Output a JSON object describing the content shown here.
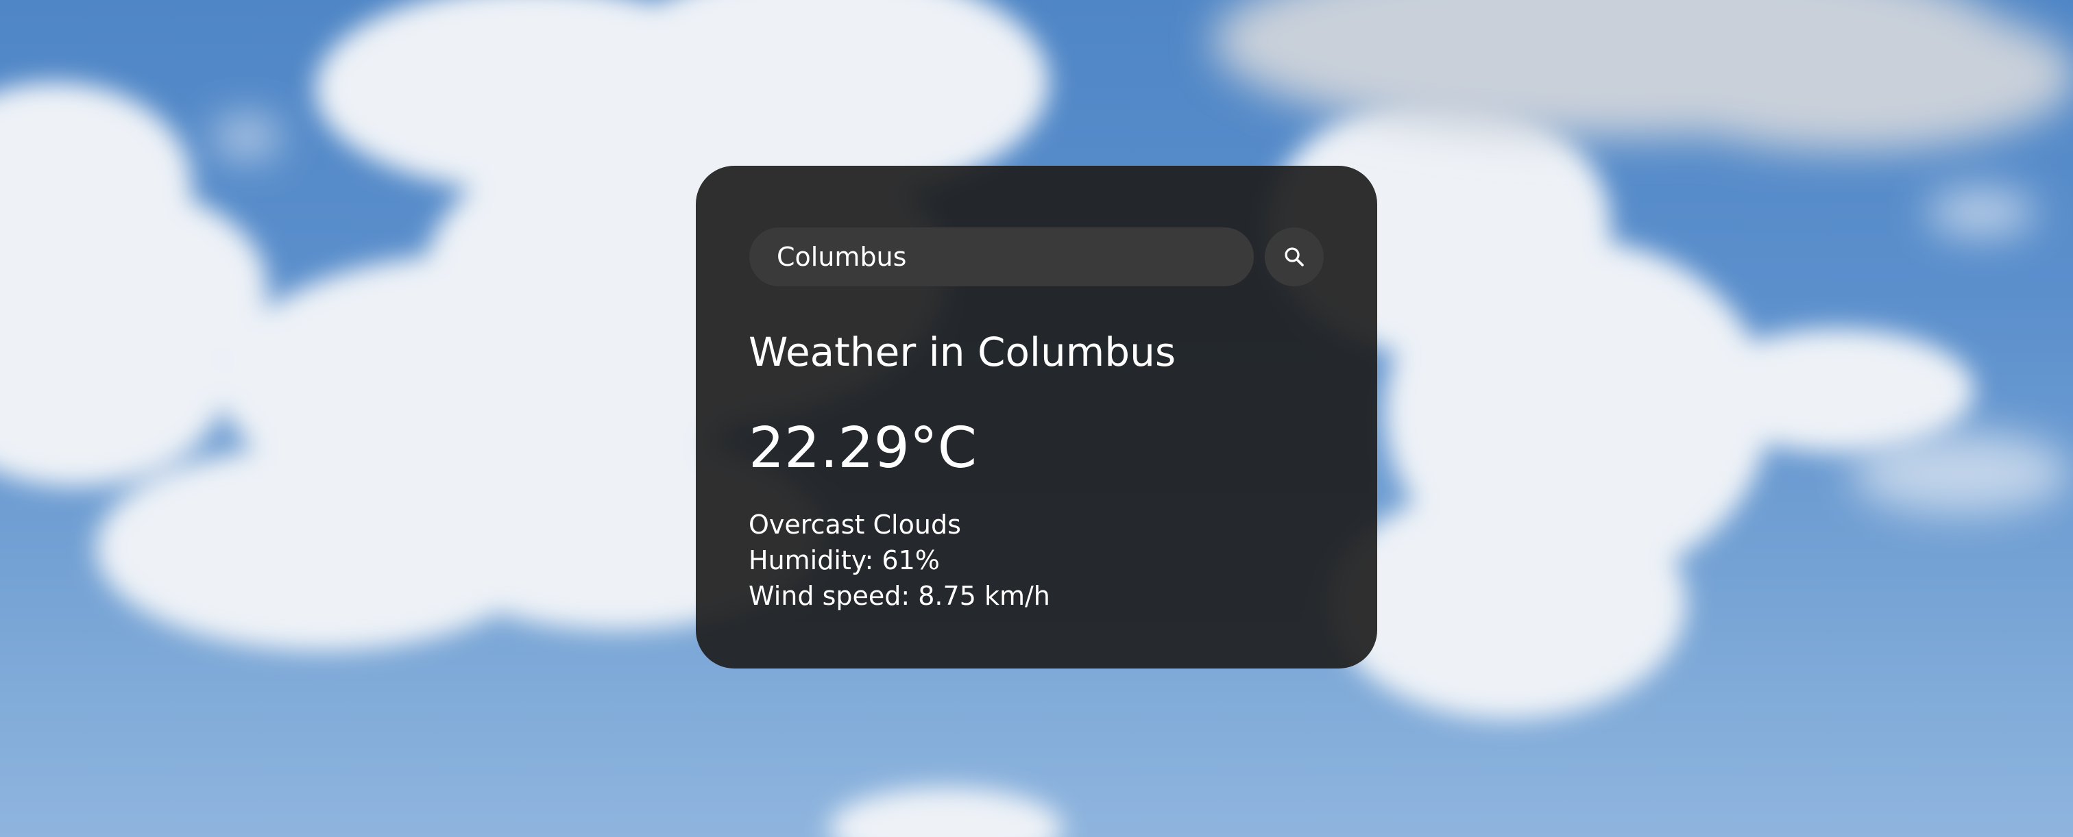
{
  "search": {
    "value": "Columbus",
    "icon": "search-icon"
  },
  "weather": {
    "title": "Weather in Columbus",
    "temperature": "22.29°C",
    "description": "Overcast Clouds",
    "humidity": "Humidity: 61%",
    "wind": "Wind speed: 8.75 km/h"
  },
  "colors": {
    "sky": "#5b8fcc",
    "card": "#1e1e1e",
    "input": "#3a3a3a",
    "text": "#ffffff"
  }
}
